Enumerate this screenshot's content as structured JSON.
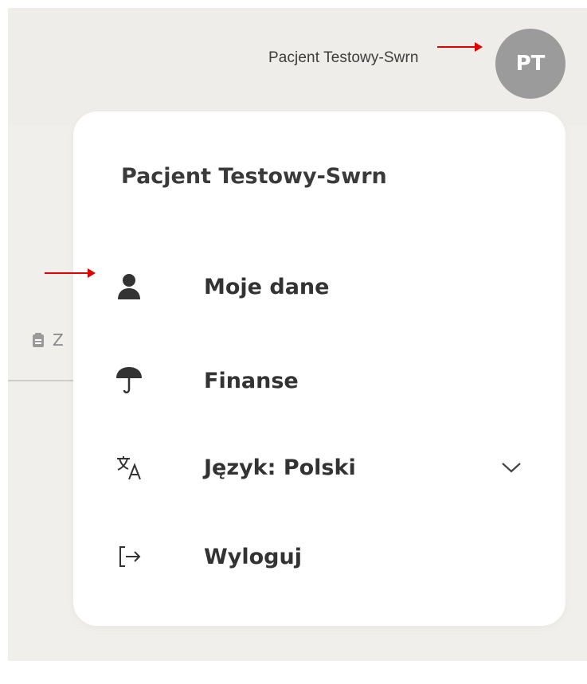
{
  "header": {
    "user_name": "Pacjent Testowy-Swrn",
    "avatar_initials": "PT"
  },
  "background_tab": {
    "label": "Z",
    "icon": "clipboard-icon"
  },
  "dropdown": {
    "title": "Pacjent Testowy-Swrn",
    "items": [
      {
        "label": "Moje dane",
        "icon": "user-icon"
      },
      {
        "label": "Finanse",
        "icon": "umbrella-icon"
      },
      {
        "label": "Język: Polski",
        "icon": "translate-icon",
        "expandable": true
      },
      {
        "label": "Wyloguj",
        "icon": "logout-icon"
      }
    ]
  },
  "colors": {
    "background": "#f1efec",
    "avatar": "#9b9b9b",
    "text": "#333333",
    "annotation_arrow": "#e00000"
  }
}
